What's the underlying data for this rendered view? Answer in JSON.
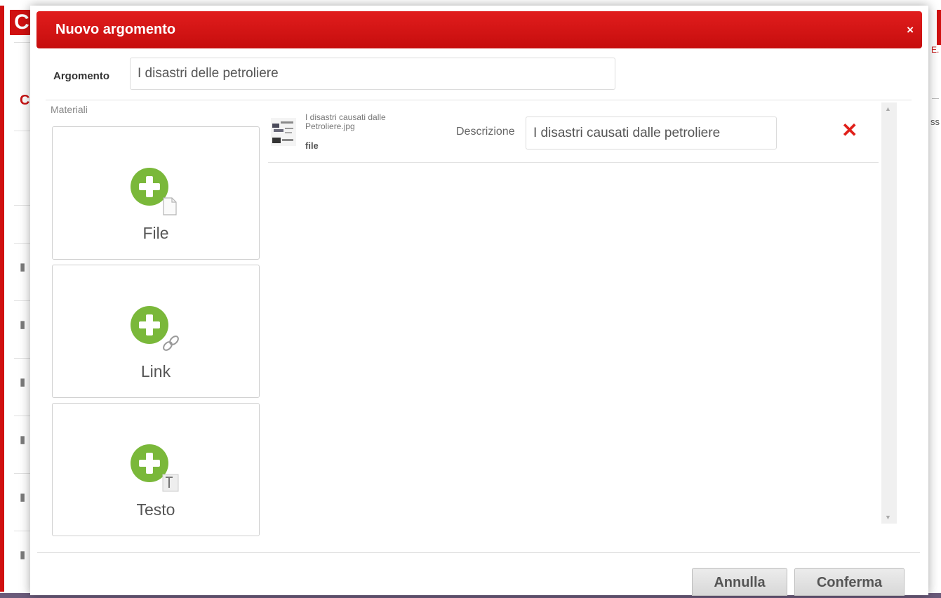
{
  "modal": {
    "title": "Nuovo argomento",
    "close_symbol": "×"
  },
  "argomento": {
    "label": "Argomento",
    "value": "I disastri delle petroliere"
  },
  "materiali": {
    "label": "Materiali",
    "tiles": [
      {
        "label": "File",
        "badge_icon": "file-icon"
      },
      {
        "label": "Link",
        "badge_icon": "link-icon"
      },
      {
        "label": "Testo",
        "badge_icon": "text-icon"
      }
    ],
    "items": [
      {
        "filename": "I disastri causati dalle Petroliere.jpg",
        "type": "file",
        "description_label": "Descrizione",
        "description_value": "I disastri causati dalle petroliere",
        "delete_symbol": "✕"
      }
    ]
  },
  "buttons": {
    "cancel": "Annulla",
    "confirm": "Conferma"
  },
  "background": {
    "logo_letter": "C",
    "red_letter": "C",
    "right_text_1": "E.",
    "right_text_2": "ss",
    "folder_icon": "folder-icon"
  },
  "colors": {
    "header_red": "#d01010",
    "add_green": "#7ab83a",
    "delete_red": "#e0201a"
  }
}
